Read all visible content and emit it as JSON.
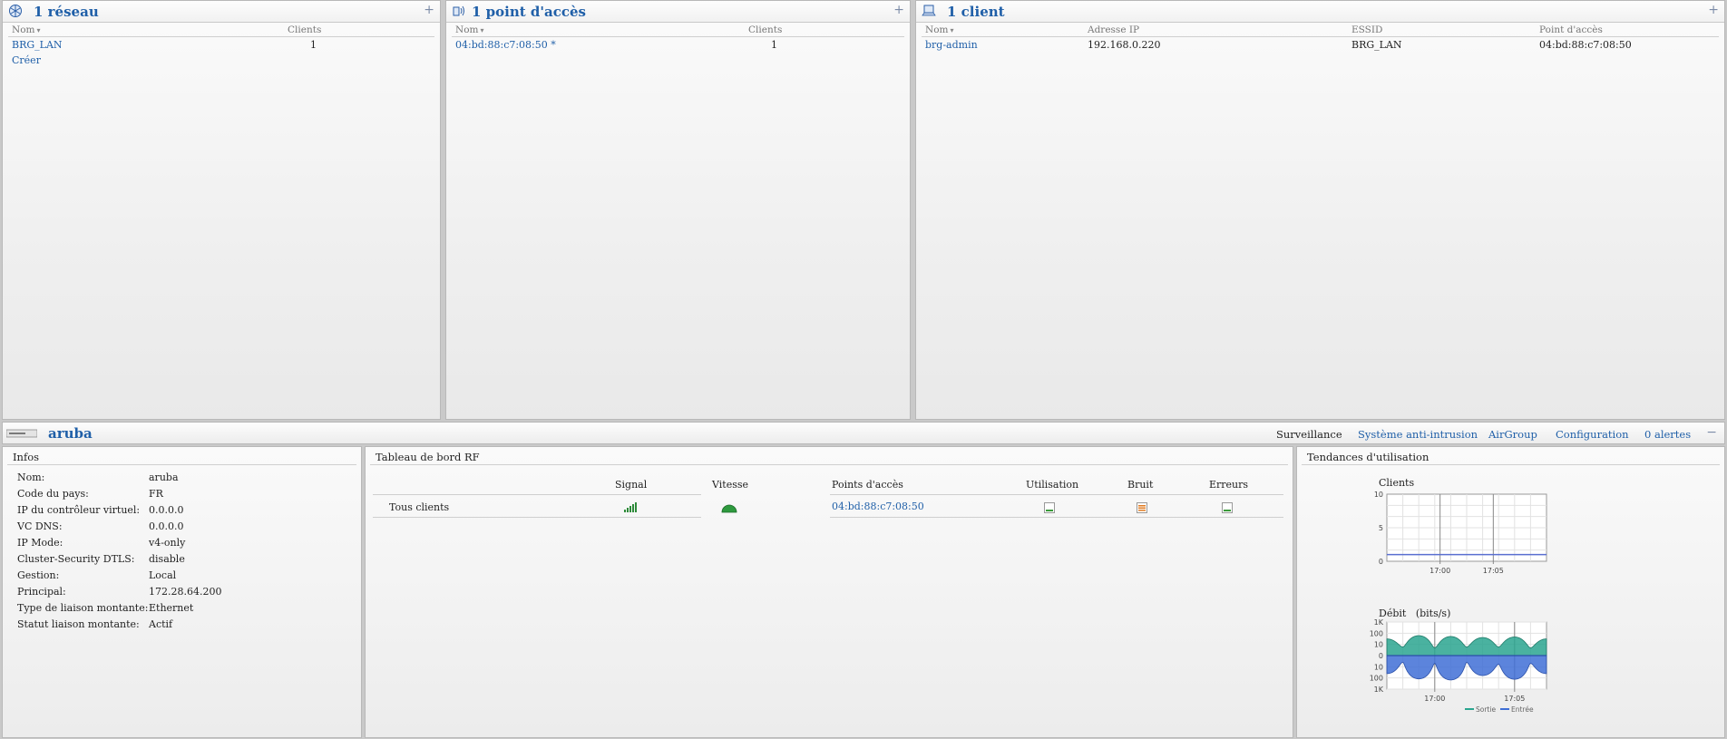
{
  "networks": {
    "title": "1 réseau",
    "add_icon": "+",
    "columns": [
      "Nom",
      "Clients"
    ],
    "rows": [
      {
        "name": "BRG_LAN",
        "clients": "1"
      }
    ],
    "create_link": "Créer"
  },
  "access_points": {
    "title": "1 point d'accès",
    "add_icon": "+",
    "columns": [
      "Nom",
      "Clients"
    ],
    "rows": [
      {
        "name": "04:bd:88:c7:08:50 *",
        "clients": "1"
      }
    ]
  },
  "clients": {
    "title": "1 client",
    "add_icon": "+",
    "columns": [
      "Nom",
      "Adresse IP",
      "ESSID",
      "Point d'accès"
    ],
    "rows": [
      {
        "name": "brg-admin",
        "ip": "192.168.0.220",
        "essid": "BRG_LAN",
        "ap": "04:bd:88:c7:08:50"
      }
    ]
  },
  "bar": {
    "title": "aruba",
    "tabs": [
      "Surveillance",
      "Système anti-intrusion",
      "AirGroup",
      "Configuration",
      "0 alertes"
    ],
    "collapse_icon": "−"
  },
  "info": {
    "title": "Infos",
    "items": [
      {
        "key": "Nom:",
        "value": "aruba"
      },
      {
        "key": "Code du pays:",
        "value": "FR"
      },
      {
        "key": "IP du contrôleur virtuel:",
        "value": "0.0.0.0"
      },
      {
        "key": "VC DNS:",
        "value": "0.0.0.0"
      },
      {
        "key": "IP Mode:",
        "value": "v4-only"
      },
      {
        "key": "Cluster-Security DTLS:",
        "value": "disable"
      },
      {
        "key": "Gestion:",
        "value": "Local"
      },
      {
        "key": "Principal:",
        "value": "172.28.64.200"
      },
      {
        "key": "Type de liaison montante:",
        "value": "Ethernet"
      },
      {
        "key": "Statut liaison montante:",
        "value": "Actif"
      }
    ]
  },
  "rf": {
    "title": "Tableau de bord RF",
    "headers": {
      "signal": "Signal",
      "speed": "Vitesse",
      "aps": "Points d'accès",
      "util": "Utilisation",
      "noise": "Bruit",
      "errors": "Erreurs"
    },
    "row_label": "Tous clients",
    "ap_link": "04:bd:88:c7:08:50",
    "colors": {
      "signal": "#2e8b3a",
      "speed": "#2e9a3e",
      "noise": "#e07b22",
      "util": "#3a9a3a"
    }
  },
  "trends": {
    "title": "Tendances d'utilisation",
    "clients_chart": {
      "title": "Clients",
      "y_ticks": [
        "10",
        "5",
        "0"
      ],
      "x_ticks": [
        "17:00",
        "17:05"
      ]
    },
    "throughput_chart": {
      "title": "Débit",
      "unit": "(bits/s)",
      "y_ticks": [
        "1K",
        "100",
        "10",
        "0",
        "10",
        "100",
        "1K"
      ],
      "x_ticks": [
        "17:00",
        "17:05"
      ],
      "legend": [
        "Sortie",
        "Entrée"
      ],
      "colors": {
        "out": "#2aa58f",
        "in": "#3f6fd6"
      }
    }
  },
  "chart_data": [
    {
      "type": "line",
      "title": "Clients",
      "x": [
        "16:57",
        "17:00",
        "17:05",
        "17:07"
      ],
      "series": [
        {
          "values": [
            1,
            1,
            1,
            1
          ]
        }
      ],
      "ylim": [
        0,
        10
      ],
      "grid": true
    },
    {
      "type": "area",
      "title": "Débit",
      "ylabel": "(bits/s)",
      "x": [
        "16:57",
        "16:58",
        "16:59",
        "17:00",
        "17:01",
        "17:02",
        "17:03",
        "17:04",
        "17:05",
        "17:06",
        "17:07"
      ],
      "series": [
        {
          "name": "Sortie",
          "values": [
            30,
            5,
            60,
            4,
            50,
            5,
            40,
            5,
            45,
            4,
            30
          ]
        },
        {
          "name": "Entrée",
          "values": [
            -40,
            -3,
            -120,
            -4,
            -150,
            -3,
            -60,
            -5,
            -130,
            -4,
            -40
          ]
        }
      ],
      "ylim": [
        -1000,
        1000
      ],
      "scale": "log",
      "grid": true,
      "legend": "bottom-right"
    }
  ]
}
